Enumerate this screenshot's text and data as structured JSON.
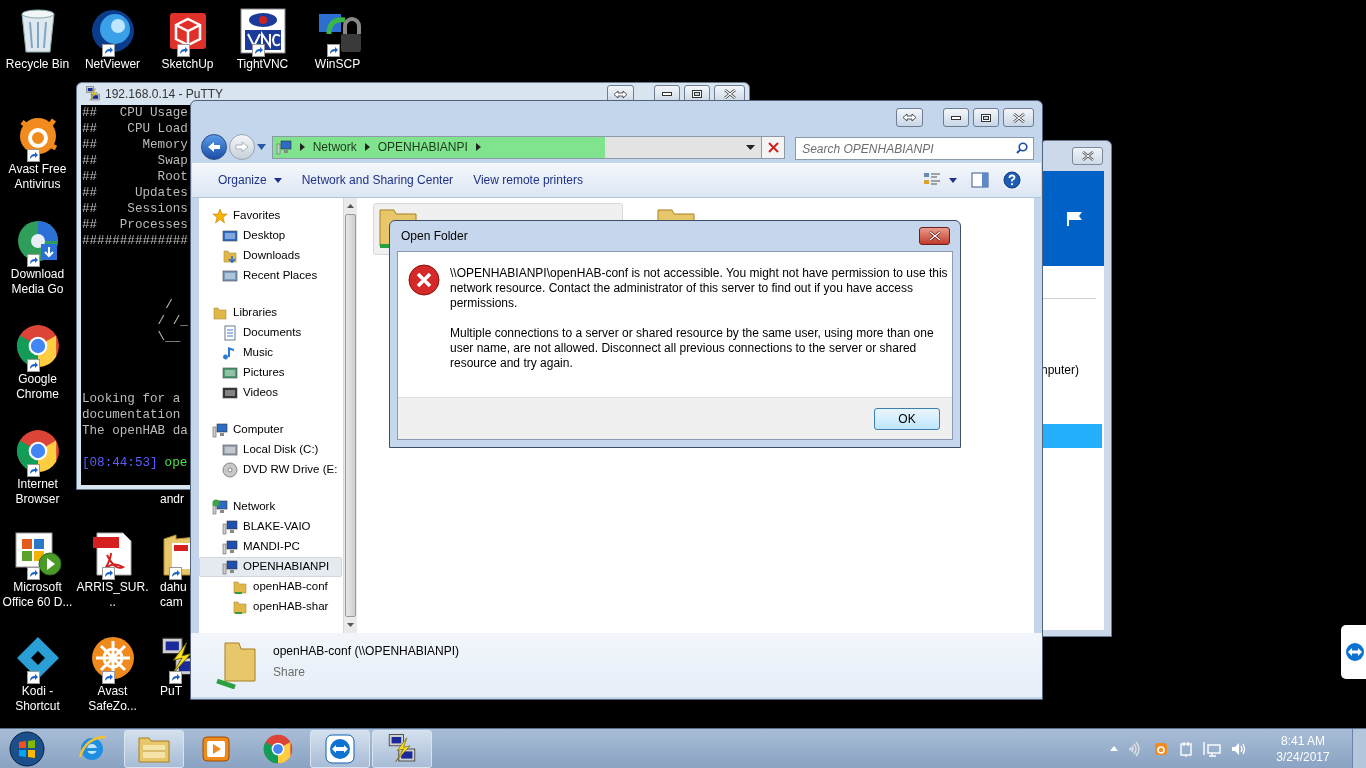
{
  "desktop_icons": [
    {
      "kind": "recycle",
      "label": "Recycle Bin"
    },
    {
      "kind": "netviewer",
      "label": "NetViewer"
    },
    {
      "kind": "sketchup",
      "label": "SketchUp"
    },
    {
      "kind": "vnc",
      "label": "TightVNC"
    },
    {
      "kind": "winscp",
      "label": "WinSCP"
    },
    {
      "kind": "avast",
      "label": "Avast Free Antivirus"
    },
    {
      "kind": "mediago",
      "label": "Download Media Go"
    },
    {
      "kind": "chrome",
      "label": "Google Chrome"
    },
    {
      "kind": "chrome",
      "label": "Internet Browser"
    },
    {
      "kind": "office",
      "label": "Microsoft Office 60 D..."
    },
    {
      "kind": "kodi",
      "label": "Kodi - Shortcut"
    },
    {
      "kind": "pdf",
      "label": "ARRIS_SUR..."
    },
    {
      "kind": "safezone",
      "label": "Avast SafeZo..."
    },
    {
      "kind": "hidden",
      "label": "andr"
    },
    {
      "kind": "folder",
      "label": "dahu cam"
    },
    {
      "kind": "putty",
      "label": "PuT"
    }
  ],
  "side_window": {
    "text": "nputer)"
  },
  "putty": {
    "title": "192.168.0.14 - PuTTY",
    "header_lines": [
      "##   CPU Usage",
      "##    CPU Load",
      "##      Memory",
      "##        Swap",
      "##        Root",
      "##     Updates",
      "##    Sessions",
      "##   Processes",
      "##############"
    ],
    "art_lines": [
      "           /",
      "          / /_",
      "          \\__"
    ],
    "footer_lines": [
      "Looking for a",
      "documentation",
      "The openHAB da"
    ],
    "prompt": {
      "time": "[08:44:53]",
      "user": "ope"
    }
  },
  "explorer": {
    "address": {
      "crumbs": [
        "Network",
        "OPENHABIANPI"
      ],
      "level": 0.65
    },
    "search": {
      "placeholder": "Search OPENHABIANPI"
    },
    "toolbar": [
      {
        "label": "Organize",
        "kind": "menu"
      },
      {
        "label": "Network and Sharing Center",
        "kind": "plain"
      },
      {
        "label": "View remote printers",
        "kind": "plain"
      }
    ],
    "nav": [
      {
        "label": "Favorites",
        "kind": "star",
        "selected": false,
        "children": [
          {
            "label": "Desktop",
            "kind": "desktop",
            "selected": false
          },
          {
            "label": "Downloads",
            "kind": "downloads",
            "selected": false
          },
          {
            "label": "Recent Places",
            "kind": "recent",
            "selected": false
          }
        ]
      },
      {
        "label": "Libraries",
        "kind": "libraries",
        "selected": false,
        "children": [
          {
            "label": "Documents",
            "kind": "documents",
            "selected": false
          },
          {
            "label": "Music",
            "kind": "music",
            "selected": false
          },
          {
            "label": "Pictures",
            "kind": "pictures",
            "selected": false
          },
          {
            "label": "Videos",
            "kind": "videos",
            "selected": false
          }
        ]
      },
      {
        "label": "Computer",
        "kind": "computer",
        "selected": false,
        "children": [
          {
            "label": "Local Disk (C:)",
            "kind": "disk",
            "selected": false
          },
          {
            "label": "DVD RW Drive (E:",
            "kind": "dvd",
            "selected": false
          }
        ]
      },
      {
        "label": "Network",
        "kind": "network",
        "selected": false,
        "children": [
          {
            "label": "BLAKE-VAIO",
            "kind": "pc",
            "selected": false
          },
          {
            "label": "MANDI-PC",
            "kind": "pc",
            "selected": false
          },
          {
            "label": "OPENHABIANPI",
            "kind": "pc",
            "selected": true,
            "children": [
              {
                "label": "openHAB-conf",
                "kind": "share",
                "selected": false
              },
              {
                "label": "openHAB-shar",
                "kind": "share",
                "selected": false
              }
            ]
          }
        ]
      }
    ],
    "items": [
      {
        "selected": true
      },
      {
        "selected": false
      }
    ],
    "details": {
      "name": "openHAB-conf (\\\\OPENHABIANPI)",
      "type": "Share"
    }
  },
  "dialog": {
    "title": "Open Folder",
    "paragraphs": [
      "\\\\OPENHABIANPI\\openHAB-conf is not accessible. You might not have permission to use this network resource. Contact the administrator of this server to find out if you have access permissions.",
      "Multiple connections to a server or shared resource by the same user, using more than one user name, are not allowed. Disconnect all previous connections to the server or shared resource and try again."
    ],
    "button": "OK"
  },
  "taskbar": {
    "pinned": [
      {
        "kind": "ie",
        "running": false
      },
      {
        "kind": "explorer",
        "running": true
      },
      {
        "kind": "wmp",
        "running": false
      },
      {
        "kind": "chrome",
        "running": false
      },
      {
        "kind": "teamviewer",
        "running": true
      },
      {
        "kind": "putty",
        "running": true
      }
    ],
    "tray": [
      {
        "kind": "show_hidden"
      },
      {
        "kind": "wireless"
      },
      {
        "kind": "avast"
      },
      {
        "kind": "power"
      },
      {
        "kind": "network"
      },
      {
        "kind": "volume"
      }
    ],
    "clock": {
      "time": "8:41 AM",
      "date": "3/24/2017"
    }
  }
}
